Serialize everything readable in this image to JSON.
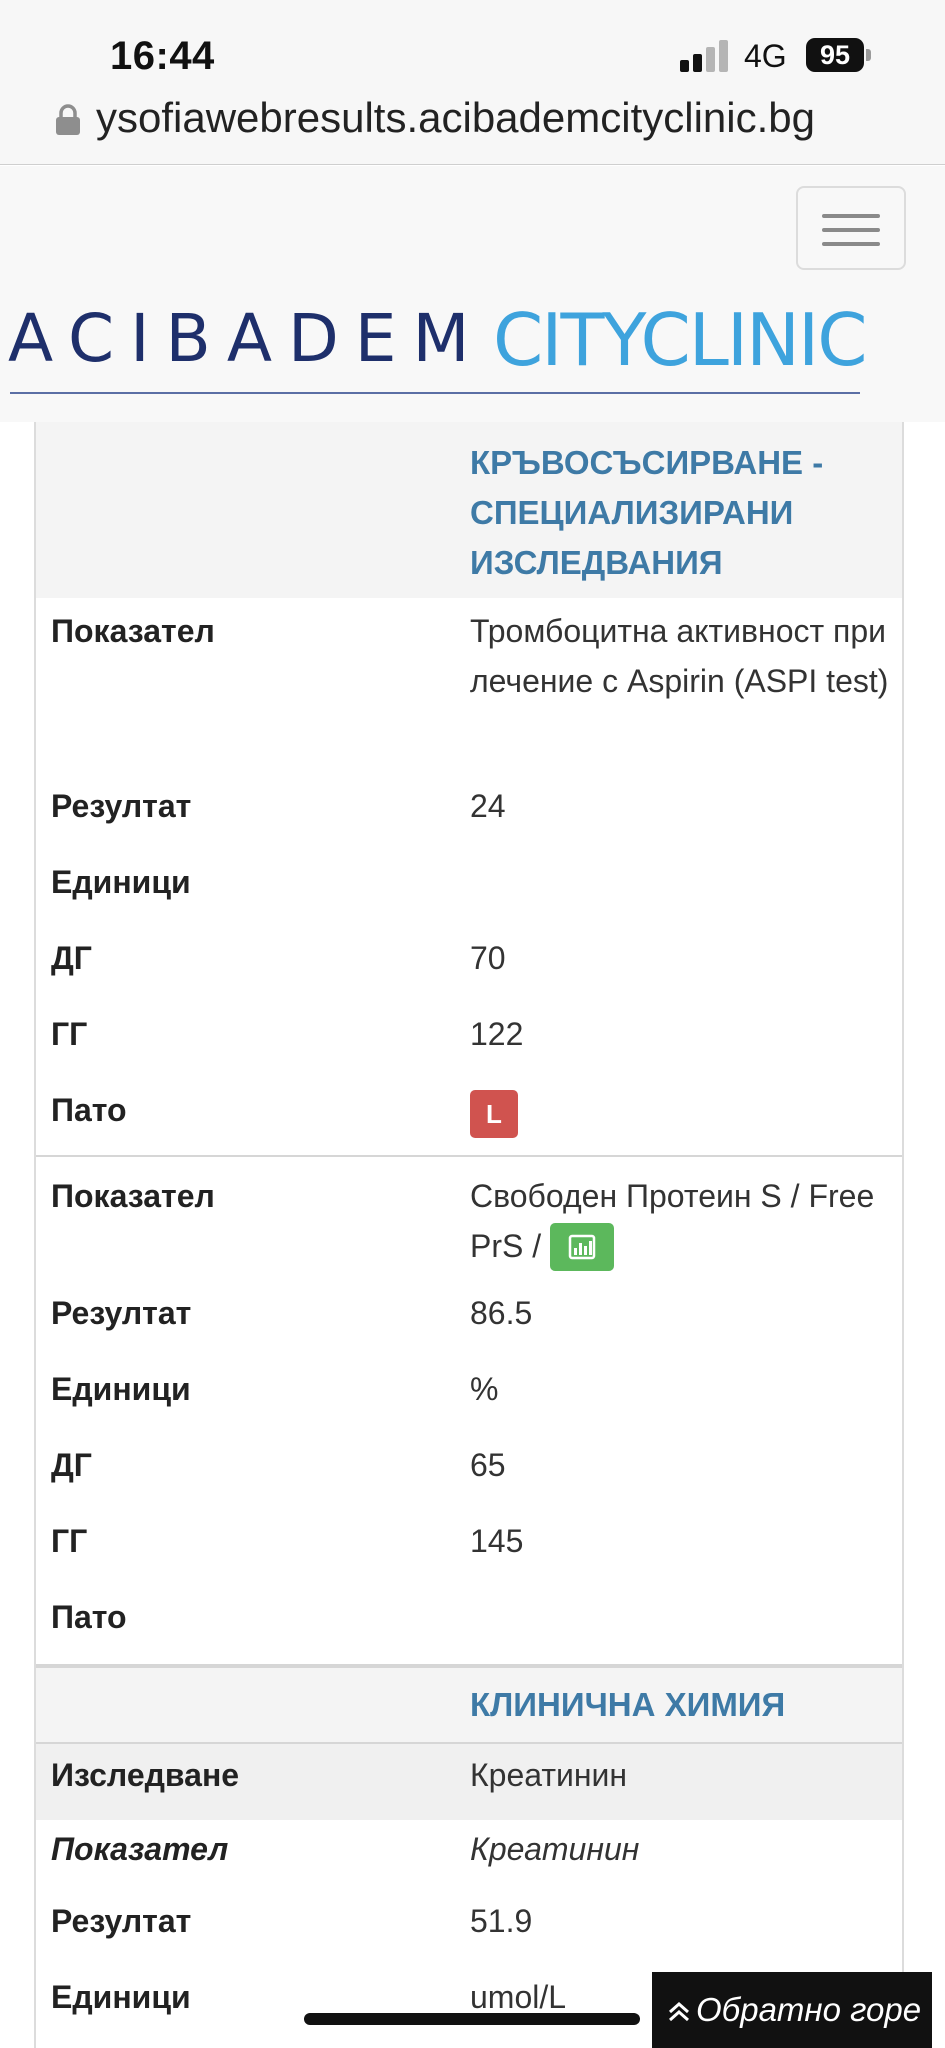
{
  "status_bar": {
    "time": "16:44",
    "network": "4G",
    "battery": "95"
  },
  "browser": {
    "url": "ysofiawebresults.acibademcityclinic.bg"
  },
  "header": {
    "logo_left": "ACIBADEM",
    "logo_right": "CITYCLINIC",
    "logo_left_color": "#1e2f6b",
    "logo_right_color": "#3ea3dd"
  },
  "sections": [
    {
      "title": "КРЪВОСЪСИРВАНЕ - СПЕЦИАЛИЗИРАНИ ИЗСЛЕДВАНИЯ",
      "tests": [
        {
          "labels": {
            "indicator": "Показател",
            "result": "Резултат",
            "units": "Единици",
            "lower": "ДГ",
            "upper": "ГГ",
            "patho": "Пато"
          },
          "indicator": "Тромбоцитна активност при лечение с Aspirin (ASPI test)",
          "result": "24",
          "units": "",
          "lower": "70",
          "upper": "122",
          "patho": "L",
          "patho_color": "#d0534f"
        },
        {
          "labels": {
            "indicator": "Показател",
            "result": "Резултат",
            "units": "Единици",
            "lower": "ДГ",
            "upper": "ГГ",
            "patho": "Пато"
          },
          "indicator": "Свободен Протеин S / Free PrS /",
          "chart_icon": "bar-chart-icon",
          "result": "86.5",
          "units": "%",
          "lower": "65",
          "upper": "145",
          "patho": ""
        }
      ]
    },
    {
      "title": "КЛИНИЧНА ХИМИЯ",
      "tests": [
        {
          "labels": {
            "study": "Изследване",
            "indicator": "Показател",
            "result": "Резултат",
            "units": "Единици"
          },
          "study": "Креатинин",
          "indicator": "Креатинин",
          "result": "51.9",
          "units": "umol/L"
        }
      ]
    }
  ],
  "back_to_top": "Обратно горе"
}
